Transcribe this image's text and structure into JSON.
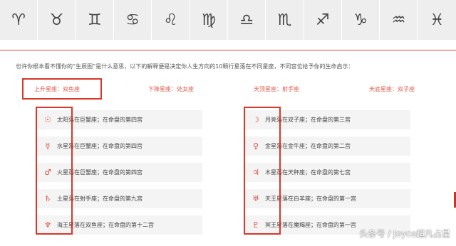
{
  "zodiac_signs": [
    {
      "symbol": "♈",
      "icon": "aries-icon"
    },
    {
      "symbol": "♉",
      "icon": "taurus-icon"
    },
    {
      "symbol": "♊",
      "icon": "gemini-icon"
    },
    {
      "symbol": "♋",
      "icon": "cancer-icon"
    },
    {
      "symbol": "♌",
      "icon": "leo-icon"
    },
    {
      "symbol": "♍",
      "icon": "virgo-icon"
    },
    {
      "symbol": "♎",
      "icon": "libra-icon"
    },
    {
      "symbol": "♏",
      "icon": "scorpio-icon"
    },
    {
      "symbol": "♐",
      "icon": "sagittarius-icon"
    },
    {
      "symbol": "♑",
      "icon": "capricorn-icon"
    },
    {
      "symbol": "♒",
      "icon": "aquarius-icon"
    },
    {
      "symbol": "♓",
      "icon": "pisces-icon"
    }
  ],
  "intro": "也许你根本看不懂你的“生辰图”是什么意思，以下的解释便是决定你人生方向的10颗行星落在不同星座，不同宫位给予你的生命启示：",
  "angles": {
    "ascendant": "上升星座：双鱼座",
    "descendant": "下降星座：处女座",
    "midheaven": "天顶星座：射手座",
    "imum_coeli": "天底星座：双子座"
  },
  "planets_left": [
    {
      "glyph": "☉",
      "icon": "sun-icon",
      "text": "太阳落在巨蟹座；在命盘的第四宫"
    },
    {
      "glyph": "☿",
      "icon": "mercury-icon",
      "text": "水星落在巨蟹座；在命盘的第四宫"
    },
    {
      "glyph": "♂",
      "icon": "mars-icon",
      "text": "火星落在巨蟹座；在命盘的第四宫"
    },
    {
      "glyph": "♄",
      "icon": "saturn-icon",
      "text": "土星落在射手座；在命盘的第九宫"
    },
    {
      "glyph": "♆",
      "icon": "neptune-icon",
      "text": "海王星落在双鱼座；在命盘的第十二宫"
    }
  ],
  "planets_right": [
    {
      "glyph": "☽",
      "icon": "moon-icon",
      "text": "月亮落在双子座；在命盘的第三宫"
    },
    {
      "glyph": "♀",
      "icon": "venus-icon",
      "text": "金星落在金牛座；在命盘的第二宫"
    },
    {
      "glyph": "♃",
      "icon": "jupiter-icon",
      "text": "木星落在天秤座；在命盘的第七宫"
    },
    {
      "glyph": "♅",
      "icon": "uranus-icon",
      "text": "天王星落在白羊座；在命盘的第一宫"
    },
    {
      "glyph": "♇",
      "icon": "pluto-icon",
      "text": "冥王星落在魔羯座；在命盘的第一宫"
    }
  ],
  "watermark": "头条号 / Joyce超凡占星",
  "colors": {
    "accent": "#d94b3a",
    "bar": "#eeeeee",
    "card": "#f4f4f4"
  }
}
